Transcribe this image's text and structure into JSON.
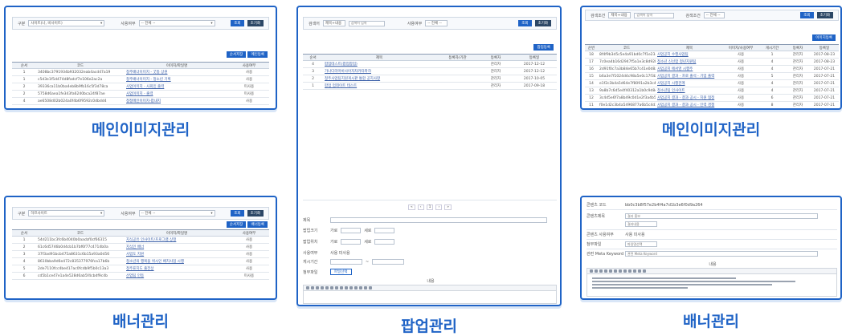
{
  "captions": {
    "main_image_1": "메인이미지관리",
    "banner_1": "배너관리",
    "popup": "팝업관리",
    "main_image_2": "메인이미지관리",
    "banner_2": "배너관리"
  },
  "panel_main_image_1": {
    "search": {
      "label_type": "구분",
      "type_value": "사이트(나, 비사이트)",
      "label_use": "사용여부",
      "use_value": "-- 전체 --",
      "btn_search": "조회",
      "btn_reset": "초기화"
    },
    "btn_order": "순서저장",
    "btn_register": "메인등록",
    "columns": [
      "순서",
      "코드",
      "이미지/파일명",
      "사용여부"
    ],
    "rows": [
      {
        "n": "1",
        "code": "3408bc3791934b932032eab4acd47a19",
        "name": "청주배너이미지 - 굿틈 상원",
        "use": "사용"
      },
      {
        "n": "1",
        "code": "c5d3e1f5d474d8fadcf7e106e2ac2a",
        "name": "청주배너이미지 - 청소년 기획",
        "use": "사용"
      },
      {
        "n": "2",
        "code": "39336ca11b0ba4eb8b9fb16c5f3d78ca",
        "name": "사업이미지 - 사회민 출력",
        "use": "미사용"
      },
      {
        "n": "2",
        "code": "5758d6aea1fe343fa6240bca24f87ae",
        "name": "사업이미지 - 출력",
        "use": "미사용"
      },
      {
        "n": "4",
        "code": "ae6508d02b024a0f4b6f9592c0dbdd4",
        "name": "청정메인이미지-팝내지",
        "use": "사용"
      }
    ]
  },
  "panel_banner_1": {
    "search": {
      "label_type": "구분",
      "type_value": "하프사이트",
      "label_use": "사용여부",
      "use_value": "-- 전체 --",
      "btn_search": "조회",
      "btn_reset": "초기화"
    },
    "btn_order": "순서저장",
    "btn_register": "배너등록",
    "columns": [
      "순서",
      "코드",
      "이미지/파일명",
      "사용여부"
    ],
    "rows": [
      {
        "n": "1",
        "code": "54d211bc3fc6b4040b0aacbf0cf66315",
        "name": "지식공유 인사이트/프로그램 상정",
        "use": "사용"
      },
      {
        "n": "2",
        "code": "61c6d5746b0d4cb1b7bf6f77c4714b0a",
        "name": "지식인 배너",
        "use": "사용"
      },
      {
        "n": "3",
        "code": "37f3ad91bcb475a8631c6b15a93a0d56",
        "name": "사업도 지원",
        "use": "사용"
      },
      {
        "n": "4",
        "code": "8610bba9d6e472c835377976fca17b6b",
        "name": "청소년의 행복을 위시인 배치사업 시행",
        "use": "사용"
      },
      {
        "n": "5",
        "code": "2de7110fcc4be417ac0fcdb9f5b0c13a3",
        "name": "청주표지도 출전상",
        "use": "사용"
      },
      {
        "n": "6",
        "code": "cd5b1ce47e1a4e528d6ab5f4cbdf9c4b",
        "name": "산업팀 인등",
        "use": "미사용"
      }
    ]
  },
  "panel_popup": {
    "search": {
      "label_type": "검색어",
      "type_value": "제목+내용",
      "placeholder": "검색어 입력",
      "label_use": "사용여부",
      "use_value": "-- 전체 --",
      "btn_search": "조회",
      "btn_reset": "초기화"
    },
    "btn_register": "팝업등록",
    "columns": [
      "순서",
      "제목",
      "등록자/기관",
      "등록자",
      "등록일"
    ],
    "rows": [
      {
        "n": "4",
        "title": "팝업테스트(팝업팝업)",
        "org": "",
        "writer": "관리자",
        "date": "2017-12-12"
      },
      {
        "n": "3",
        "title": "가나다라마바사아자차카타파하",
        "org": "",
        "writer": "관리자",
        "date": "2017-12-12"
      },
      {
        "n": "2",
        "title": "청주사업팀지원게시판 통합 공지사항",
        "org": "",
        "writer": "관리자",
        "date": "2017-10-05"
      },
      {
        "n": "1",
        "title": "팝업 업데이트 테스트",
        "org": "",
        "writer": "관리자",
        "date": "2017-09-18"
      }
    ],
    "form": {
      "label_title": "제목",
      "label_popup_size": "팝업크기",
      "label_popup_pos": "팝업위치",
      "label_use": "사용여부",
      "label_period": "게시기간",
      "label_attach": "첨부파일",
      "label_content": "내용",
      "opt_width": "가로",
      "opt_height": "세로",
      "use_options": "사용  미사용",
      "attach_btn": "파일선택"
    }
  },
  "panel_main_image_2": {
    "search": {
      "label_type": "검색조건",
      "type_value": "제목+내용",
      "placeholder": "검색어 입력",
      "label_use": "검색조건",
      "use_value": "-- 전체 --",
      "btn_search": "조회",
      "btn_reset": "초기화"
    },
    "btn_register": "이미지등록",
    "columns": [
      "순번",
      "코드",
      "제목",
      "이미지/사용여부",
      "게시기간",
      "등록자",
      "등록일"
    ],
    "rows": [
      {
        "n": "18",
        "code": "8f4f9b3d5c5e4a91bd0c7f1e23a4b610",
        "title": "사업공지 수행사업팀",
        "use": "사용",
        "period": "1",
        "writer": "관리자",
        "date": "2017-08-23"
      },
      {
        "n": "17",
        "code": "7c0ea4b16d2947f5a1e3c8d92b6f0a37",
        "title": "청소년 신선함 청년지원팀",
        "use": "사용",
        "period": "4",
        "writer": "관리자",
        "date": "2017-08-23"
      },
      {
        "n": "16",
        "code": "2d91f0c7a3b84e65b7c41e0d8a9f2c53",
        "title": "사업공지 에서영 시행주",
        "use": "사용",
        "period": "4",
        "writer": "관리자",
        "date": "2017-07-21"
      },
      {
        "n": "15",
        "code": "b6a3e7f1024d4c98a5e0c17f3b28d461",
        "title": "사업공지 결과 - 프로 출석 - 기업 출력",
        "use": "사용",
        "period": "5",
        "writer": "관리자",
        "date": "2017-07-21"
      },
      {
        "n": "14",
        "code": "e1f2c3b4a5d64e7f8091a2b3c4d5e6f7",
        "title": "사업공지 시행관계",
        "use": "사용",
        "period": "4",
        "writer": "관리자",
        "date": "2017-07-21"
      },
      {
        "n": "13",
        "code": "9a8b7c6d5e4f40312a1b0c9d8e7f6a5b",
        "title": "청소년팀 인사이트",
        "use": "사용",
        "period": "4",
        "writer": "관리자",
        "date": "2017-07-21"
      },
      {
        "n": "12",
        "code": "3c4d5e6f7a8b49c0d1e2f3a4b5c6d7e8",
        "title": "사업공지 결과 - 결과 공시 - 지원 협정",
        "use": "사용",
        "period": "6",
        "writer": "관리자",
        "date": "2017-07-21"
      },
      {
        "n": "11",
        "code": "f0e1d2c3b4a5496877a6b5c4d3e2f1a0",
        "title": "사업공지 결과 - 결과 공시 - 인력 경쟁",
        "use": "사용",
        "period": "8",
        "writer": "관리자",
        "date": "2017-07-21"
      },
      {
        "n": "10",
        "code": "5b6c7d8e9f0a41b2c3d4e5f6a7b8c9d0",
        "title": "사업공지 결과 - 결과 공시 - 운영 철정",
        "use": "사용",
        "period": "9",
        "writer": "관리자",
        "date": "2017-07-21"
      },
      {
        "n": "9",
        "code": "a7b8c9d0e1f24a3b5c6d7e8f9a0b1c2d",
        "title": "사업공지 결과 - 결과 공시 - 지원 의결",
        "use": "사용",
        "period": "4",
        "writer": "관리자",
        "date": "2017-07-21"
      }
    ]
  },
  "panel_banner_2": {
    "form": {
      "label_code": "콘텐츠 코드",
      "code_value": "bb0c3b8f57e2b4f4a7d1b3e6f0d9a264",
      "label_title": "콘텐츠제목",
      "title_value": "결과 홍보",
      "title_sub": "결과내용",
      "label_use": "콘텐츠 사용여부",
      "use_value": "사용  미사용",
      "label_file": "첨부파일",
      "file_value": "파일명선택",
      "label_meta": "관련 Meta Keyword",
      "meta_value": "관련 Meta Keyword",
      "label_content": "내용"
    }
  }
}
